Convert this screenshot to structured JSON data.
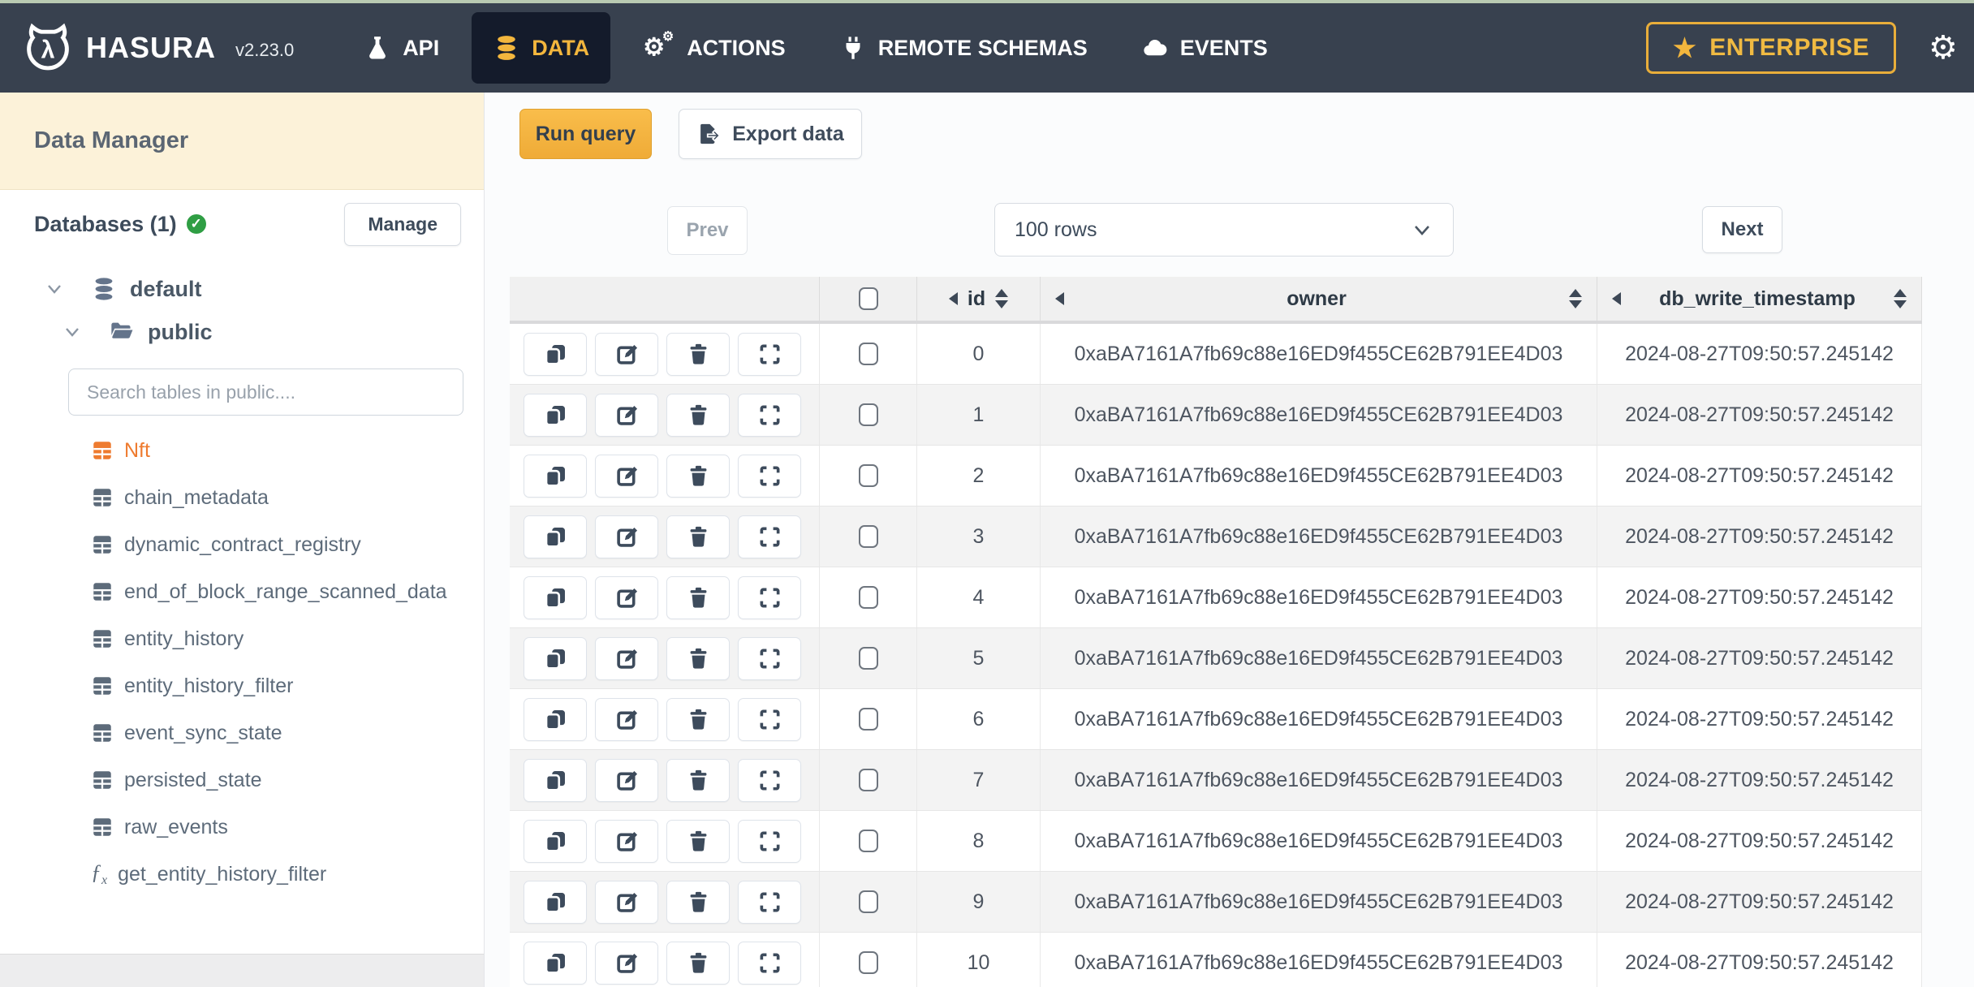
{
  "nav": {
    "brand": "HASURA",
    "version": "v2.23.0",
    "items": [
      {
        "label": "API",
        "icon": "flask-icon",
        "active": false
      },
      {
        "label": "DATA",
        "icon": "database-icon",
        "active": true
      },
      {
        "label": "ACTIONS",
        "icon": "cogs-icon",
        "active": false
      },
      {
        "label": "REMOTE SCHEMAS",
        "icon": "plug-icon",
        "active": false
      },
      {
        "label": "EVENTS",
        "icon": "cloud-icon",
        "active": false
      }
    ],
    "enterprise_label": "ENTERPRISE"
  },
  "sidebar": {
    "title": "Data Manager",
    "databases_label": "Databases (1)",
    "manage_button": "Manage",
    "tree": {
      "database": "default",
      "schema": "public"
    },
    "search_placeholder": "Search tables in public....",
    "tables": [
      {
        "name": "Nft",
        "selected": true
      },
      {
        "name": "chain_metadata",
        "selected": false
      },
      {
        "name": "dynamic_contract_registry",
        "selected": false
      },
      {
        "name": "end_of_block_range_scanned_data",
        "selected": false
      },
      {
        "name": "entity_history",
        "selected": false
      },
      {
        "name": "entity_history_filter",
        "selected": false
      },
      {
        "name": "event_sync_state",
        "selected": false
      },
      {
        "name": "persisted_state",
        "selected": false
      },
      {
        "name": "raw_events",
        "selected": false
      }
    ],
    "function_item": "get_entity_history_filter"
  },
  "toolbar": {
    "run_query": "Run query",
    "export_data": "Export data"
  },
  "pagination": {
    "prev": "Prev",
    "rows_select": "100 rows",
    "next": "Next"
  },
  "table": {
    "columns": [
      "id",
      "owner",
      "db_write_timestamp"
    ],
    "rows": [
      {
        "id": "0",
        "owner": "0xaBA7161A7fb69c88e16ED9f455CE62B791EE4D03",
        "db_write_timestamp": "2024-08-27T09:50:57.245142"
      },
      {
        "id": "1",
        "owner": "0xaBA7161A7fb69c88e16ED9f455CE62B791EE4D03",
        "db_write_timestamp": "2024-08-27T09:50:57.245142"
      },
      {
        "id": "2",
        "owner": "0xaBA7161A7fb69c88e16ED9f455CE62B791EE4D03",
        "db_write_timestamp": "2024-08-27T09:50:57.245142"
      },
      {
        "id": "3",
        "owner": "0xaBA7161A7fb69c88e16ED9f455CE62B791EE4D03",
        "db_write_timestamp": "2024-08-27T09:50:57.245142"
      },
      {
        "id": "4",
        "owner": "0xaBA7161A7fb69c88e16ED9f455CE62B791EE4D03",
        "db_write_timestamp": "2024-08-27T09:50:57.245142"
      },
      {
        "id": "5",
        "owner": "0xaBA7161A7fb69c88e16ED9f455CE62B791EE4D03",
        "db_write_timestamp": "2024-08-27T09:50:57.245142"
      },
      {
        "id": "6",
        "owner": "0xaBA7161A7fb69c88e16ED9f455CE62B791EE4D03",
        "db_write_timestamp": "2024-08-27T09:50:57.245142"
      },
      {
        "id": "7",
        "owner": "0xaBA7161A7fb69c88e16ED9f455CE62B791EE4D03",
        "db_write_timestamp": "2024-08-27T09:50:57.245142"
      },
      {
        "id": "8",
        "owner": "0xaBA7161A7fb69c88e16ED9f455CE62B791EE4D03",
        "db_write_timestamp": "2024-08-27T09:50:57.245142"
      },
      {
        "id": "9",
        "owner": "0xaBA7161A7fb69c88e16ED9f455CE62B791EE4D03",
        "db_write_timestamp": "2024-08-27T09:50:57.245142"
      },
      {
        "id": "10",
        "owner": "0xaBA7161A7fb69c88e16ED9f455CE62B791EE4D03",
        "db_write_timestamp": "2024-08-27T09:50:57.245142"
      }
    ]
  },
  "colors": {
    "nav_bg": "#38414f",
    "nav_active_bg": "#141b2b",
    "accent_yellow": "#f3b63d",
    "sidebar_header_bg": "#fcf2d9",
    "selected_table_orange": "#ee7b2f",
    "status_green": "#2f9e44",
    "header_gray": "#f0f0f0",
    "stripe_gray": "#f3f3f3"
  }
}
